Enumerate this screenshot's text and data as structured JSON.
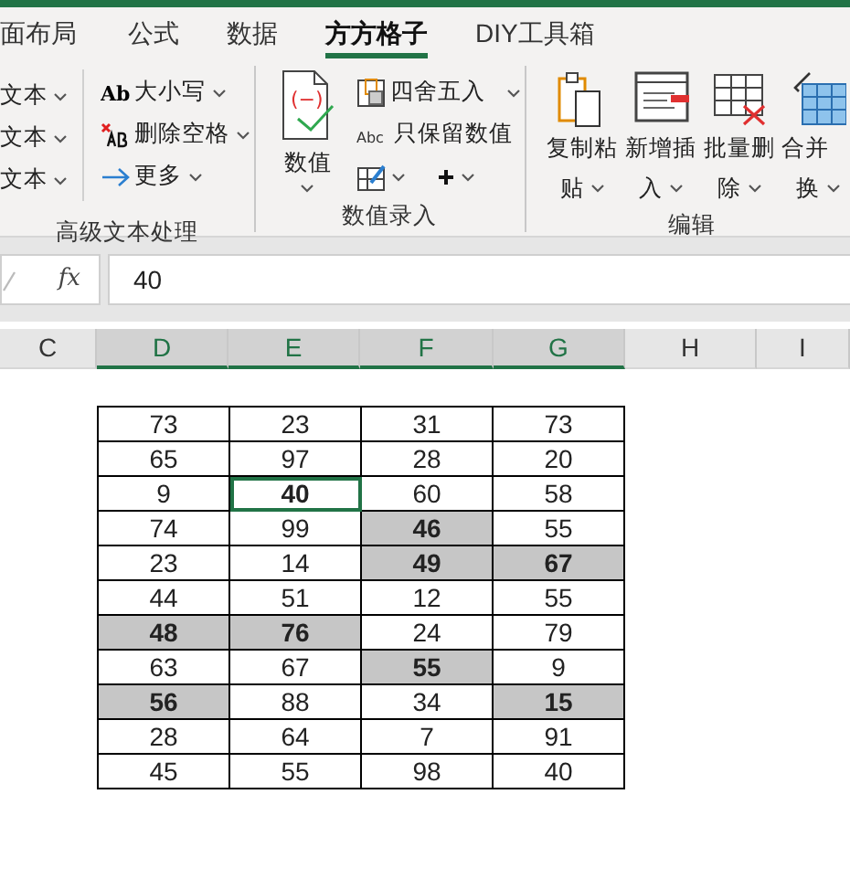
{
  "tabs": [
    {
      "label": "面布局",
      "selected": false
    },
    {
      "label": "公式",
      "selected": false
    },
    {
      "label": "数据",
      "selected": false
    },
    {
      "label": "方方格子",
      "selected": true
    },
    {
      "label": "DIY工具箱",
      "selected": false
    }
  ],
  "text_group": {
    "label": "高级文本处理",
    "cut_items": [
      "文本",
      "文本",
      "文本"
    ],
    "items": [
      "大小写",
      "删除空格",
      "更多"
    ],
    "case_icon_text": "Ab"
  },
  "number_group": {
    "label": "数值录入",
    "big_button": "数值",
    "big_icon_text": "(−)",
    "items": [
      "四舍五入",
      "只保留数值"
    ],
    "abc_icon_text": "Abc"
  },
  "edit_group": {
    "label": "编辑",
    "buttons": [
      [
        "复制粘",
        "贴"
      ],
      [
        "新增插",
        "入"
      ],
      [
        "批量删",
        "除"
      ],
      [
        "合并",
        "换"
      ]
    ]
  },
  "formula_bar": {
    "function_label": "fx",
    "value": "40"
  },
  "columns": [
    {
      "label": "C",
      "selected": false
    },
    {
      "label": "D",
      "selected": true
    },
    {
      "label": "E",
      "selected": true
    },
    {
      "label": "F",
      "selected": true
    },
    {
      "label": "G",
      "selected": true
    },
    {
      "label": "H",
      "selected": false
    },
    {
      "label": "I",
      "selected": false
    }
  ],
  "table": {
    "rows": [
      [
        {
          "text": "73",
          "bold": false,
          "highlighted": false,
          "selected": false
        },
        {
          "text": "23",
          "bold": false,
          "highlighted": false,
          "selected": false
        },
        {
          "text": "31",
          "bold": false,
          "highlighted": false,
          "selected": false
        },
        {
          "text": "73",
          "bold": false,
          "highlighted": false,
          "selected": false
        }
      ],
      [
        {
          "text": "65",
          "bold": false,
          "highlighted": false,
          "selected": false
        },
        {
          "text": "97",
          "bold": false,
          "highlighted": false,
          "selected": false
        },
        {
          "text": "28",
          "bold": false,
          "highlighted": false,
          "selected": false
        },
        {
          "text": "20",
          "bold": false,
          "highlighted": false,
          "selected": false
        }
      ],
      [
        {
          "text": "9",
          "bold": false,
          "highlighted": false,
          "selected": false
        },
        {
          "text": "40",
          "bold": true,
          "highlighted": false,
          "selected": true
        },
        {
          "text": "60",
          "bold": false,
          "highlighted": false,
          "selected": false
        },
        {
          "text": "58",
          "bold": false,
          "highlighted": false,
          "selected": false
        }
      ],
      [
        {
          "text": "74",
          "bold": false,
          "highlighted": false,
          "selected": false
        },
        {
          "text": "99",
          "bold": false,
          "highlighted": false,
          "selected": false
        },
        {
          "text": "46",
          "bold": true,
          "highlighted": true,
          "selected": false
        },
        {
          "text": "55",
          "bold": false,
          "highlighted": false,
          "selected": false
        }
      ],
      [
        {
          "text": "23",
          "bold": false,
          "highlighted": false,
          "selected": false
        },
        {
          "text": "14",
          "bold": false,
          "highlighted": false,
          "selected": false
        },
        {
          "text": "49",
          "bold": true,
          "highlighted": true,
          "selected": false
        },
        {
          "text": "67",
          "bold": true,
          "highlighted": true,
          "selected": false
        }
      ],
      [
        {
          "text": "44",
          "bold": false,
          "highlighted": false,
          "selected": false
        },
        {
          "text": "51",
          "bold": false,
          "highlighted": false,
          "selected": false
        },
        {
          "text": "12",
          "bold": false,
          "highlighted": false,
          "selected": false
        },
        {
          "text": "55",
          "bold": false,
          "highlighted": false,
          "selected": false
        }
      ],
      [
        {
          "text": "48",
          "bold": true,
          "highlighted": true,
          "selected": false
        },
        {
          "text": "76",
          "bold": true,
          "highlighted": true,
          "selected": false
        },
        {
          "text": "24",
          "bold": false,
          "highlighted": false,
          "selected": false
        },
        {
          "text": "79",
          "bold": false,
          "highlighted": false,
          "selected": false
        }
      ],
      [
        {
          "text": "63",
          "bold": false,
          "highlighted": false,
          "selected": false
        },
        {
          "text": "67",
          "bold": false,
          "highlighted": false,
          "selected": false
        },
        {
          "text": "55",
          "bold": true,
          "highlighted": true,
          "selected": false
        },
        {
          "text": "9",
          "bold": false,
          "highlighted": false,
          "selected": false
        }
      ],
      [
        {
          "text": "56",
          "bold": true,
          "highlighted": true,
          "selected": false
        },
        {
          "text": "88",
          "bold": false,
          "highlighted": false,
          "selected": false
        },
        {
          "text": "34",
          "bold": false,
          "highlighted": false,
          "selected": false
        },
        {
          "text": "15",
          "bold": true,
          "highlighted": true,
          "selected": false
        }
      ],
      [
        {
          "text": "28",
          "bold": false,
          "highlighted": false,
          "selected": false
        },
        {
          "text": "64",
          "bold": false,
          "highlighted": false,
          "selected": false
        },
        {
          "text": "7",
          "bold": false,
          "highlighted": false,
          "selected": false
        },
        {
          "text": "91",
          "bold": false,
          "highlighted": false,
          "selected": false
        }
      ],
      [
        {
          "text": "45",
          "bold": false,
          "highlighted": false,
          "selected": false
        },
        {
          "text": "55",
          "bold": false,
          "highlighted": false,
          "selected": false
        },
        {
          "text": "98",
          "bold": false,
          "highlighted": false,
          "selected": false
        },
        {
          "text": "40",
          "bold": false,
          "highlighted": false,
          "selected": false
        }
      ]
    ]
  }
}
